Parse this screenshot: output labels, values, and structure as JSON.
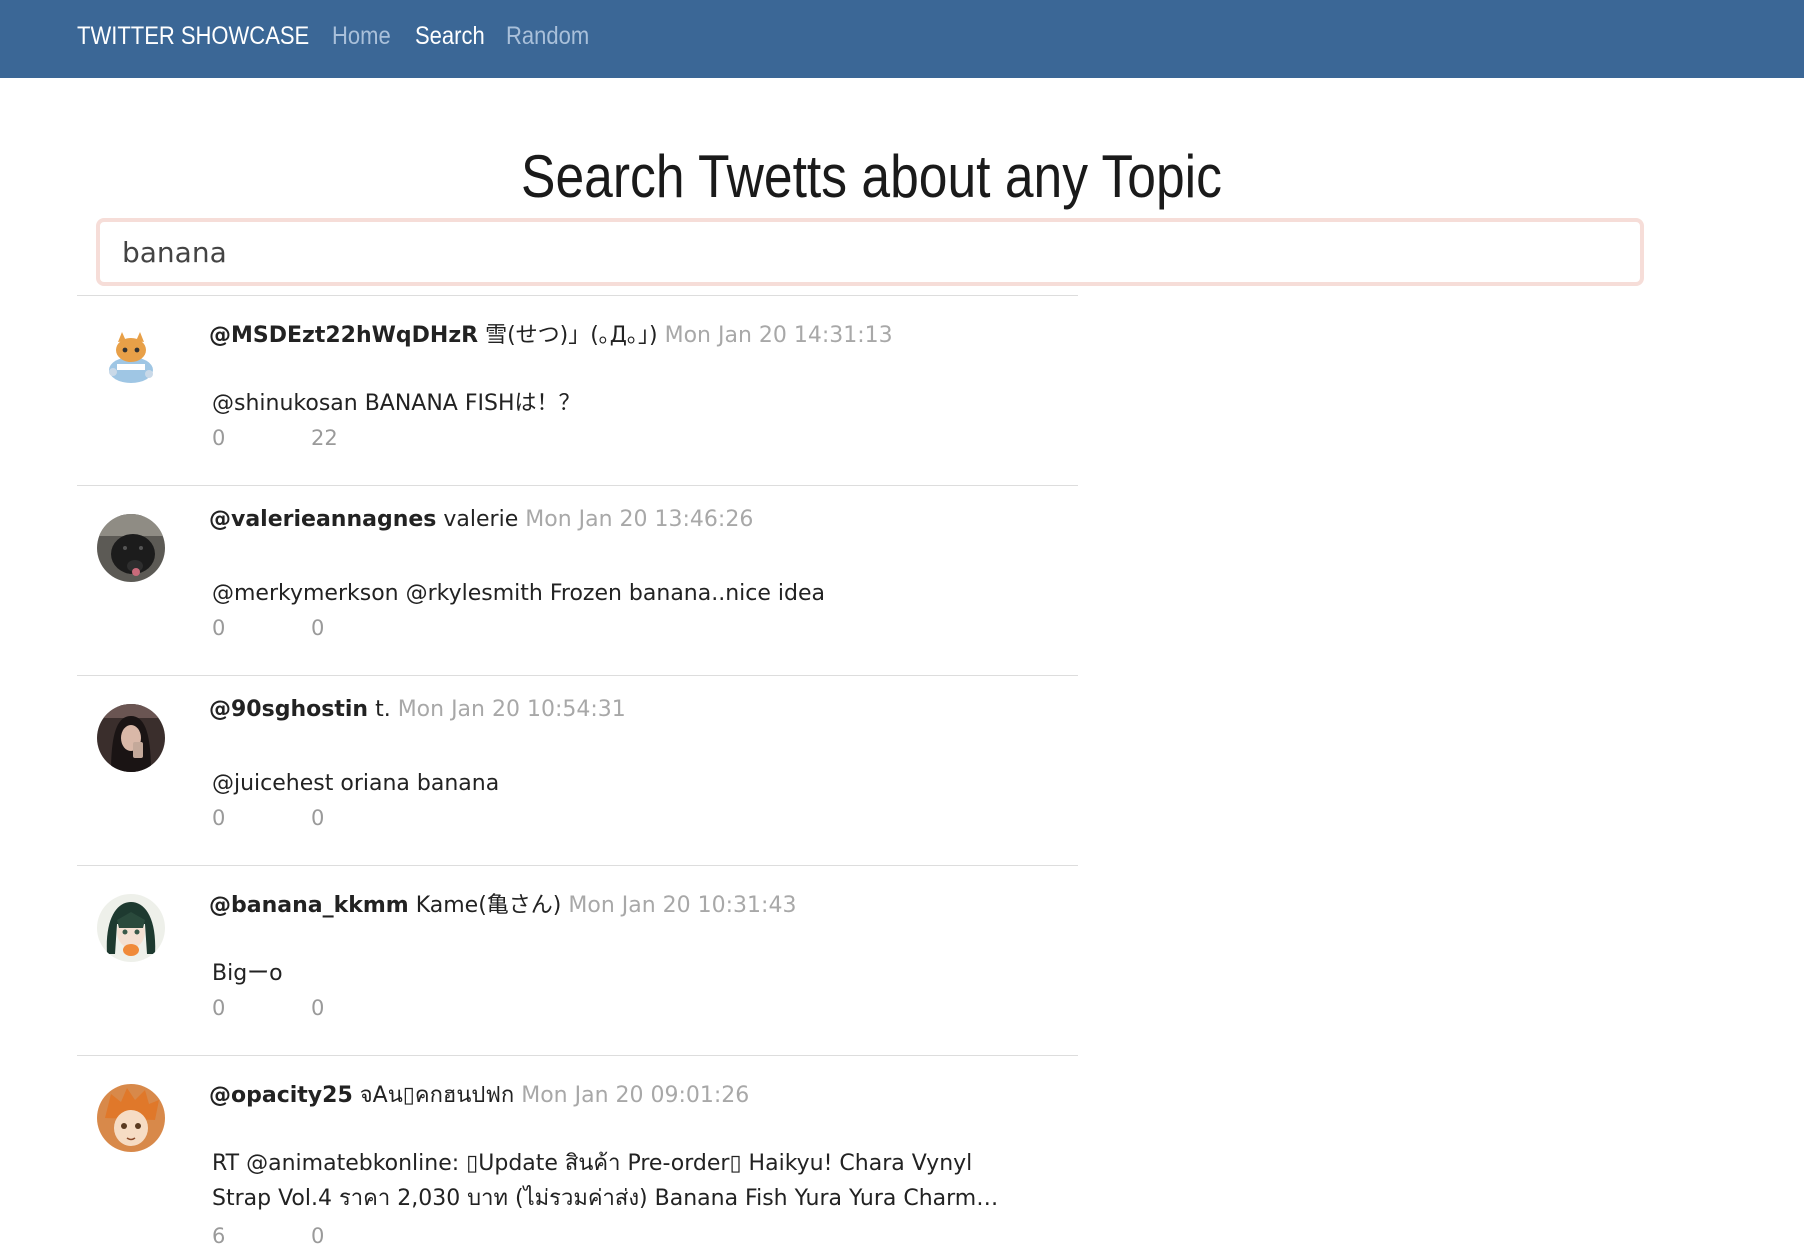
{
  "navbar": {
    "brand": "TWITTER SHOWCASE",
    "links": [
      {
        "label": "Home",
        "active": false
      },
      {
        "label": "Search",
        "active": true
      },
      {
        "label": "Random",
        "active": false
      }
    ]
  },
  "page": {
    "title": "Search Twetts about any Topic"
  },
  "search": {
    "value": "banana",
    "placeholder": ""
  },
  "tweets": [
    {
      "handle": "@MSDEzt22hWqDHzR",
      "name": "雪(せつ)」(｡Д｡」)",
      "time": "Mon Jan 20 14:31:13",
      "text": "@shinukosan BANANA FISHは！？",
      "count1": "0",
      "count2": "22",
      "avatar": "cartoon-cat-avatar"
    },
    {
      "handle": "@valerieannagnes",
      "name": "valerie",
      "time": "Mon Jan 20 13:46:26",
      "text": "@merkymerkson @rkylesmith Frozen banana..nice idea",
      "count1": "0",
      "count2": "0",
      "avatar": "dog-photo-avatar"
    },
    {
      "handle": "@90sghostin",
      "name": "t.",
      "time": "Mon Jan 20 10:54:31",
      "text": "@juicehest oriana banana",
      "count1": "0",
      "count2": "0",
      "avatar": "selfie-photo-avatar"
    },
    {
      "handle": "@banana_kkmm",
      "name": "Kame(亀さん)",
      "time": "Mon Jan 20 10:31:43",
      "text": "Bigーo",
      "count1": "0",
      "count2": "0",
      "avatar": "anime-girl-avatar"
    },
    {
      "handle": "@opacity25",
      "name": "จAน▯คกฮนปฟก",
      "time": "Mon Jan 20 09:01:26",
      "text": "RT @animatebkonline: ▯Update สินค้า Pre-order▯ Haikyu! Chara Vynyl Strap Vol.4 ราคา 2,030 บาท (ไม่รวมค่าส่ง) Banana Fish Yura Yura Charm…",
      "count1": "6",
      "count2": "0",
      "avatar": "anime-boy-avatar"
    }
  ],
  "colors": {
    "navbar": "#3b6796",
    "nav_inactive": "#a9c0da",
    "search_border": "#f6ddd8",
    "timestamp": "#a8a8a8"
  }
}
